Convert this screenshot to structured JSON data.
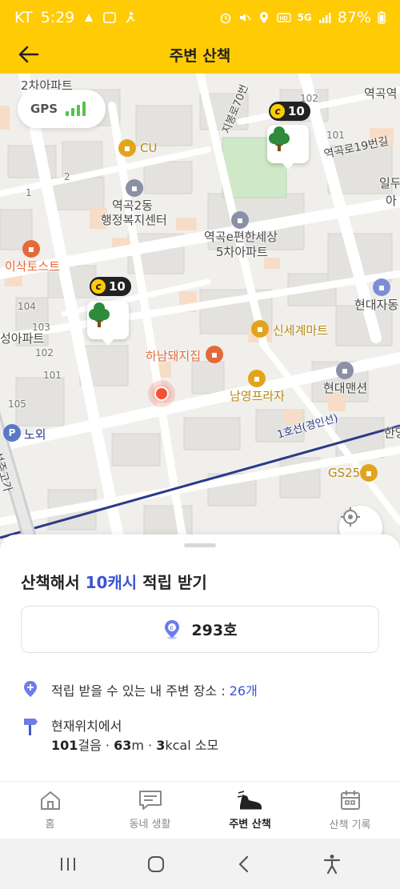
{
  "status_bar": {
    "carrier": "KT",
    "time": "5:29",
    "network": "5G",
    "battery": "87%"
  },
  "app_bar": {
    "title": "주변 산책"
  },
  "map": {
    "gps_label": "GPS",
    "gps_signal_bars": 4,
    "markers": [
      {
        "points": "10"
      },
      {
        "points": "10"
      }
    ],
    "labels": {
      "apt_top": "2차아파트",
      "cu": "CU",
      "jibong": "지봉로70번",
      "yeokgok": "역곡역",
      "yeokgok19": "역곡로19번길",
      "ildu": "일두",
      "a": "아",
      "office_1": "역곡2동",
      "office_2": "행정복지센터",
      "apt_mid_1": "역곡e편한세상",
      "apt_mid_2": "5차아파트",
      "isak": "이삭토스트",
      "hyundai_ja": "현대자동",
      "seong": "성아파트",
      "shinsegae": "신세계마트",
      "hanam": "하남돼지집",
      "namyeong": "남영프라자",
      "hyundai_mansion": "현대맨션",
      "nowoe": "노외",
      "line1": "1호선(경인선)",
      "han": "한양",
      "gs25": "GS25",
      "seongjugo": "성주고가",
      "n102": "102",
      "n101": "101",
      "n104": "104",
      "n103": "103",
      "n105": "105",
      "n2": "2",
      "n1": "1"
    }
  },
  "sheet": {
    "title_prefix": "산책해서 ",
    "title_accent": "10캐시",
    "title_suffix": " 적립 받기",
    "count": "293호",
    "places_label": "적립 받을 수 있는 내 주변 장소 : ",
    "places_value": "26개",
    "from_here": "현재위치에서",
    "steps": "101",
    "steps_unit": "걸음 · ",
    "distance": "63",
    "distance_unit": "m · ",
    "kcal": "3",
    "kcal_unit": "kcal 소모"
  },
  "bottom_nav": [
    {
      "label": "홈"
    },
    {
      "label": "동네 생활"
    },
    {
      "label": "주변 산책"
    },
    {
      "label": "산책 기록"
    }
  ],
  "colors": {
    "brand_yellow": "#ffcb05",
    "accent_blue": "#3c52d8",
    "tree_green": "#2e8b3a",
    "location_red": "#f45037"
  }
}
